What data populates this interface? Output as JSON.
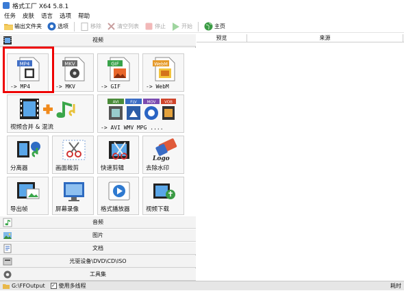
{
  "window": {
    "title": "格式工厂 X64 5.8.1"
  },
  "menu": [
    "任务",
    "皮肤",
    "语言",
    "选项",
    "帮助"
  ],
  "toolbar": {
    "output_folder": "输出文件夹",
    "options": "选项",
    "remove": "移除",
    "clear_list": "清空列表",
    "stop": "停止",
    "start": "开始",
    "home": "主页"
  },
  "categories": {
    "video": "视频",
    "audio": "音频",
    "image": "图片",
    "document": "文档",
    "rom": "光驱设备\\DVD\\CD\\ISO",
    "toolbox": "工具集"
  },
  "video_tiles": [
    {
      "label": "-> MP4",
      "icon": "mp4-file-icon",
      "badge": "MP4"
    },
    {
      "label": "-> MKV",
      "icon": "mkv-file-icon",
      "badge": "MKV"
    },
    {
      "label": "-> GIF",
      "icon": "gif-file-icon",
      "badge": "GIF"
    },
    {
      "label": "-> WebM",
      "icon": "webm-file-icon",
      "badge": "WebM"
    },
    {
      "label": "视频合并 & 混流",
      "icon": "video-merge-icon"
    },
    {
      "label": "-> AVI WMV MPG ....",
      "icon": "multi-format-icon",
      "badges": [
        "AVI",
        "FLV",
        "MOV",
        "VOB"
      ]
    },
    {
      "label": "分离器",
      "icon": "splitter-icon"
    },
    {
      "label": "画面裁剪",
      "icon": "crop-icon"
    },
    {
      "label": "快速剪辑",
      "icon": "quick-clip-icon"
    },
    {
      "label": "去除水印",
      "icon": "remove-watermark-icon",
      "logo_text": "Logo"
    },
    {
      "label": "导出帧",
      "icon": "export-frames-icon"
    },
    {
      "label": "屏幕录像",
      "icon": "screen-record-icon"
    },
    {
      "label": "格式播放器",
      "icon": "player-icon"
    },
    {
      "label": "视频下载",
      "icon": "video-download-icon"
    }
  ],
  "task_list": {
    "col_preview": "预览",
    "col_source": "来源"
  },
  "status": {
    "output_path": "G:\\FFOutput",
    "multithread_label": "使用多线程",
    "multithread_checked": true,
    "right_text": "耗时"
  }
}
